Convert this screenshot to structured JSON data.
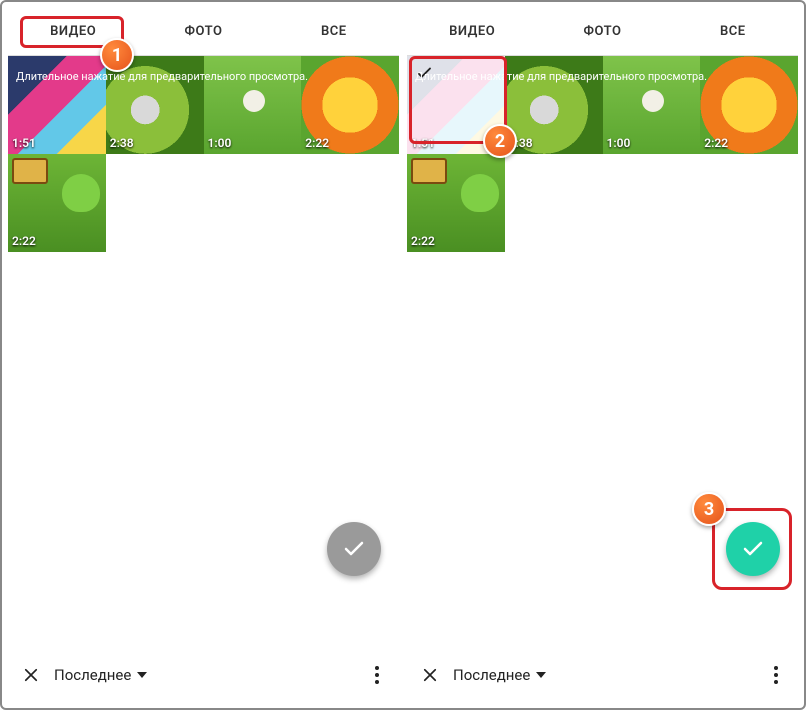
{
  "tabs": {
    "video": "ВИДЕО",
    "photo": "ФОТО",
    "all": "ВСЕ"
  },
  "hint": "Длительное нажатие для предварительного просмотра.",
  "thumbs": [
    {
      "i": 0,
      "duration": "1:51"
    },
    {
      "i": 1,
      "duration": "2:38"
    },
    {
      "i": 2,
      "duration": "1:00"
    },
    {
      "i": 3,
      "duration": "2:22"
    },
    {
      "i": 4,
      "duration": "2:22"
    }
  ],
  "bottom": {
    "label": "Последнее"
  },
  "callouts": {
    "one": "1",
    "two": "2",
    "three": "3"
  }
}
